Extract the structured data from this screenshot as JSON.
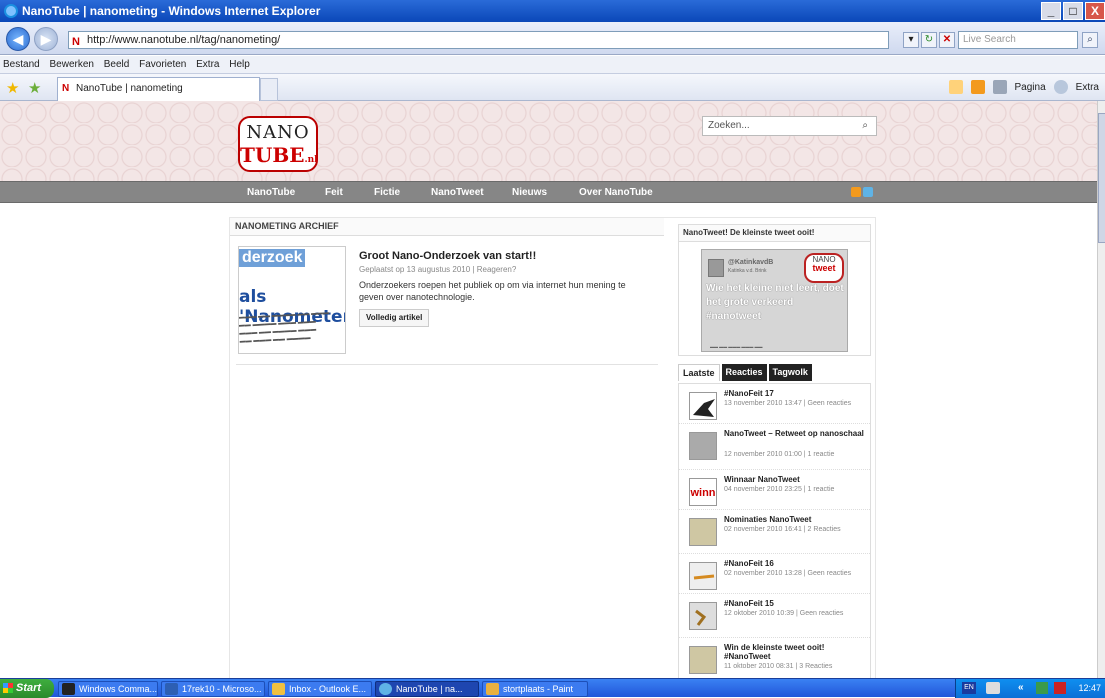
{
  "window": {
    "title": "NanoTube | nanometing - Windows Internet Explorer",
    "controls": [
      "_",
      "□",
      "X"
    ]
  },
  "addressbar": {
    "url": "http://www.nanotube.nl/tag/nanometing/",
    "search_placeholder": "Live Search"
  },
  "menu": {
    "items": [
      "Bestand",
      "Bewerken",
      "Beeld",
      "Favorieten",
      "Extra",
      "Help"
    ]
  },
  "tabbar": {
    "tab_title": "NanoTube | nanometing",
    "cmd_pagina": "Pagina",
    "cmd_extra": "Extra"
  },
  "site": {
    "logo_top": "NANO",
    "logo_bottom": "TUBE",
    "logo_suffix": ".nl",
    "search_placeholder": "Zoeken...",
    "nav": [
      "NanoTube",
      "Feit",
      "Fictie",
      "NanoTweet",
      "Nieuws",
      "Over NanoTube"
    ]
  },
  "archive": {
    "heading": "NANOMETING ARCHIEF",
    "post": {
      "image_text_1": "derzoek",
      "image_text_2": "als 'Nanometer'!",
      "title": "Groot Nano-Onderzoek van start!!",
      "meta": "Geplaatst op 13 augustus 2010 | Reageren?",
      "body": "Onderzoekers roepen het publiek op om via internet hun mening te geven over nanotechnologie.",
      "button": "Volledig artikel"
    }
  },
  "sidebar": {
    "tweet_heading": "NanoTweet! De kleinste tweet ooit!",
    "tweet_image": {
      "handle": "@KatinkavdB",
      "name": "Katinka v.d. Brink",
      "badge_top": "NANO",
      "badge_bottom": "tweet",
      "message": "Wie het kleine niet leert, doet het grote verkeerd #nanotweet"
    },
    "tabs": [
      "Laatste",
      "Reacties",
      "Tagwolk"
    ],
    "recent": [
      {
        "title": "#NanoFeit 17",
        "meta": "13 november 2010 13:47 | Geen reacties"
      },
      {
        "title": "NanoTweet – Retweet op nanoschaal",
        "meta": "12 november 2010 01:00 | 1 reactie"
      },
      {
        "title": "Winnaar NanoTweet",
        "meta": "04 november 2010 23:25 | 1 reactie"
      },
      {
        "title": "Nominaties NanoTweet",
        "meta": "02 november 2010 16:41 | 2 Reacties"
      },
      {
        "title": "#NanoFeit 16",
        "meta": "02 november 2010 13:28 | Geen reacties"
      },
      {
        "title": "#NanoFeit 15",
        "meta": "12 oktober 2010 10:39 | Geen reacties"
      },
      {
        "title": "Win de kleinste tweet ooit! #NanoTweet",
        "meta": "11 oktober 2010 08:31 | 3 Reacties"
      }
    ]
  },
  "taskbar": {
    "start": "Start",
    "items": [
      "Windows Comma...",
      "17rek10 - Microso...",
      "Inbox - Outlook E...",
      "NanoTube | na...",
      "stortplaats - Paint"
    ],
    "lang": "EN",
    "clock": "12:47"
  },
  "colors": {
    "accent_red": "#cc0000",
    "nav_gray": "#868686",
    "xp_blue": "#2256d9"
  }
}
